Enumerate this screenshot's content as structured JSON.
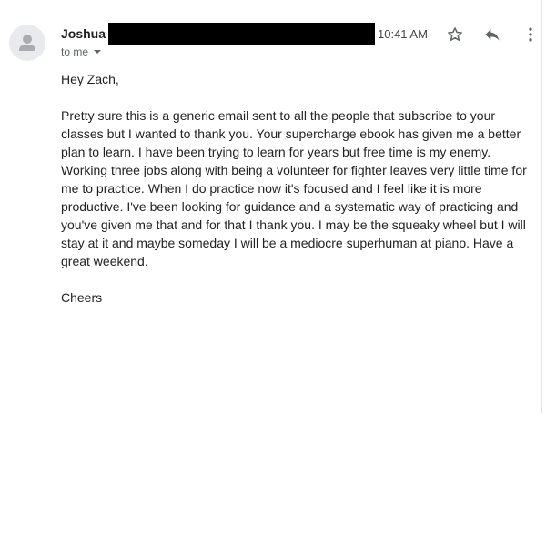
{
  "email": {
    "sender_name": "Joshua",
    "time": "10:41 AM",
    "recipient_line": "to me",
    "greeting": "Hey Zach,",
    "message": "Pretty sure this is a generic email sent to all the people that subscribe to your classes but I wanted to thank you. Your supercharge ebook has given me a better plan to learn. I have been trying to learn for years but free time is my enemy. Working three jobs along with being a volunteer for fighter leaves very little time for me to practice. When I do practice now it's focused and I feel like it is more productive. I've been looking for guidance and a systematic way of practicing and you've given me that and for that I thank you. I may be the squeaky wheel but I will stay at it and maybe someday I will be a mediocre superhuman at piano. Have a great weekend.",
    "signoff": "Cheers"
  },
  "icons": {
    "avatar": "person-icon",
    "star": "star-outline-icon",
    "reply": "reply-icon",
    "more": "more-vert-icon",
    "recipient_toggle": "caret-down-icon"
  },
  "colors": {
    "redaction": "#000000",
    "icon": "#5f6368",
    "avatar_bg": "#e8eaed"
  }
}
